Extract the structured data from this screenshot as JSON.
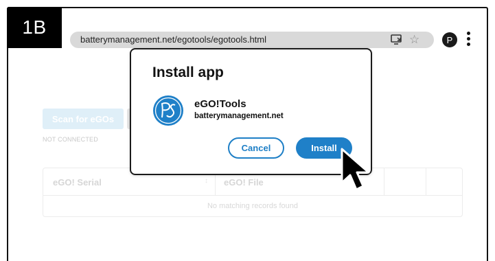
{
  "step_label": "1B",
  "browser": {
    "url": "batterymanagement.net/egotools/egotools.html",
    "icons": [
      "install-app-icon",
      "star-icon",
      "menu-icon"
    ],
    "profile_initial": "P"
  },
  "page": {
    "scan_button_label": "Scan for eGOs",
    "status": "NOT CONNECTED",
    "table": {
      "columns": [
        "eGO! Serial",
        "eGO! File"
      ],
      "empty_message": "No matching records found"
    }
  },
  "dialog": {
    "title": "Install app",
    "app_name": "eGO!Tools",
    "app_domain": "batterymanagement.net",
    "cancel_label": "Cancel",
    "install_label": "Install"
  },
  "colors": {
    "accent": "#1f80c8",
    "frame": "#111111"
  }
}
